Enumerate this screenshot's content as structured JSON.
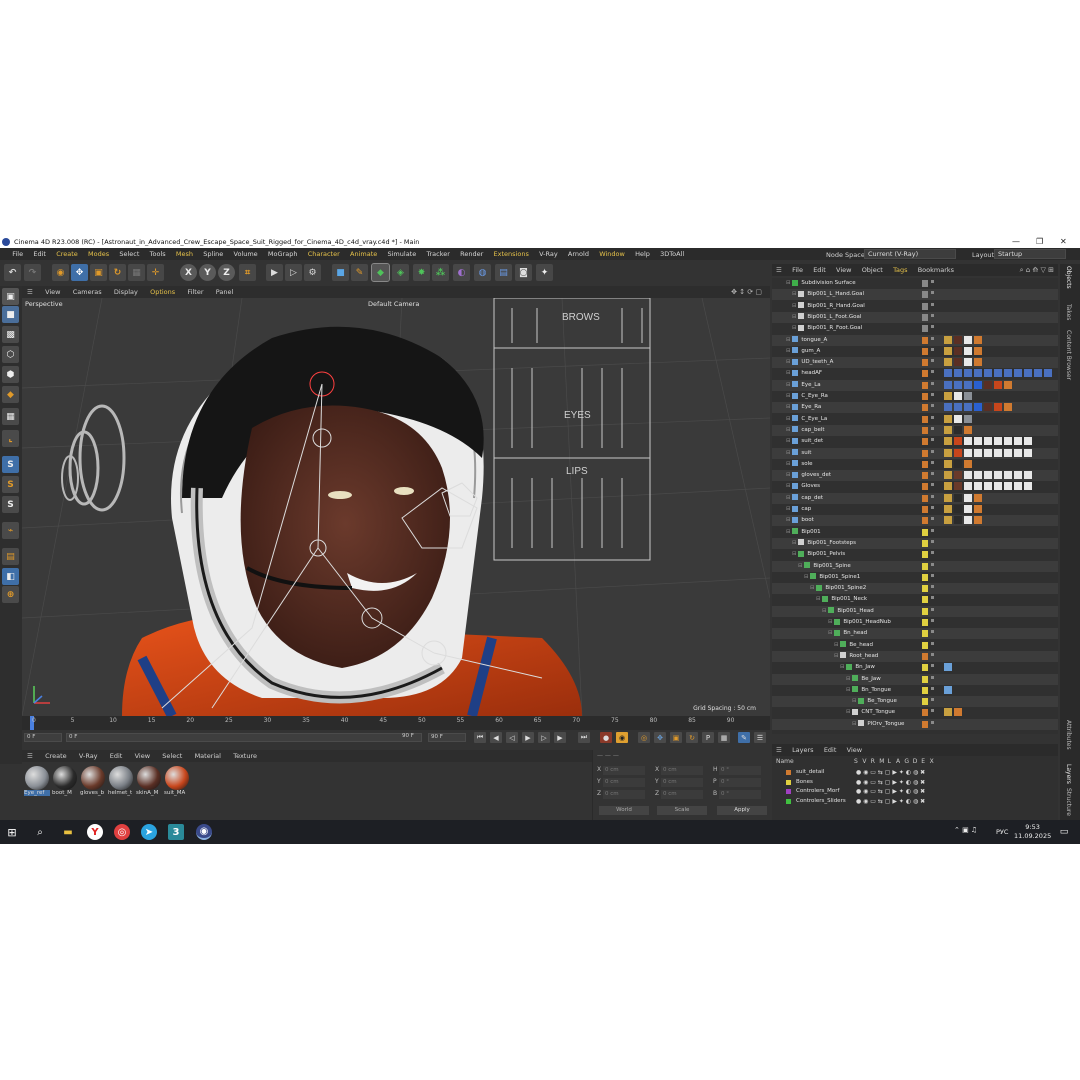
{
  "window": {
    "title": "Cinema 4D R23.008 (RC) - [Astronaut_in_Advanced_Crew_Escape_Space_Suit_Rigged_for_Cinema_4D_c4d_vray.c4d *] - Main",
    "controls": [
      "—",
      "❐",
      "✕"
    ]
  },
  "menu": [
    "File",
    "Edit",
    "Create",
    "Modes",
    "Select",
    "Tools",
    "Mesh",
    "Spline",
    "Volume",
    "MoGraph",
    "Character",
    "Animate",
    "Simulate",
    "Tracker",
    "Render",
    "Extensions",
    "V-Ray",
    "Arnold",
    "Window",
    "Help",
    "3DToAll"
  ],
  "node_space": {
    "label": "Node Space:",
    "value": "Current (V-Ray)"
  },
  "layout": {
    "label": "Layout:",
    "value": "Startup"
  },
  "viewport": {
    "menu": [
      "View",
      "Cameras",
      "Display",
      "Options",
      "Filter",
      "Panel"
    ],
    "label": "Perspective",
    "camera": "Default Camera",
    "grid_spacing": "Grid Spacing : 50 cm",
    "panel_labels": [
      "BROWS",
      "EYES",
      "LIPS"
    ]
  },
  "timeline": {
    "ticks": [
      "0",
      "5",
      "10",
      "15",
      "20",
      "25",
      "30",
      "35",
      "40",
      "45",
      "50",
      "55",
      "60",
      "65",
      "70",
      "75",
      "80",
      "85",
      "90"
    ],
    "current_frame": "0 F",
    "start": "0 F",
    "start2": "0 F",
    "end": "90 F",
    "end2": "90 F"
  },
  "materials": {
    "menu": [
      "Create",
      "V-Ray",
      "Edit",
      "View",
      "Select",
      "Material",
      "Texture"
    ],
    "items": [
      {
        "label": "Eye_ref",
        "color": "#8a8f96"
      },
      {
        "label": "boot_M",
        "color": "#2b2b2b"
      },
      {
        "label": "gloves_b",
        "color": "#6a3a2a"
      },
      {
        "label": "helmet_t",
        "color": "#7a7f86"
      },
      {
        "label": "skinA_M",
        "color": "#5a2f24"
      },
      {
        "label": "suit_MA",
        "color": "#c8461c"
      }
    ]
  },
  "coordinates": {
    "rows": [
      {
        "a": "X",
        "av": "0 cm",
        "b": "X",
        "bv": "0 cm",
        "c": "H",
        "cv": "0 °"
      },
      {
        "a": "Y",
        "av": "0 cm",
        "b": "Y",
        "bv": "0 cm",
        "c": "P",
        "cv": "0 °"
      },
      {
        "a": "Z",
        "av": "0 cm",
        "b": "Z",
        "bv": "0 cm",
        "c": "B",
        "cv": "0 °"
      }
    ],
    "mode": "World",
    "scale": "Scale",
    "apply": "Apply"
  },
  "objects": {
    "menu": [
      "File",
      "Edit",
      "View",
      "Object",
      "Tags",
      "Bookmarks"
    ],
    "rows": [
      {
        "name": "Subdivision Surface",
        "indent": 0,
        "icon": "#3fae4a",
        "color": "#888888",
        "tags": []
      },
      {
        "name": "Bip001_L_Hand.Goal",
        "indent": 1,
        "icon": "#d0d0d0",
        "color": "#888888",
        "tags": []
      },
      {
        "name": "Bip001_R_Hand.Goal",
        "indent": 1,
        "icon": "#d0d0d0",
        "color": "#888888",
        "tags": []
      },
      {
        "name": "Bip001_L_Foot.Goal",
        "indent": 1,
        "icon": "#d0d0d0",
        "color": "#888888",
        "tags": []
      },
      {
        "name": "Bip001_R_Foot.Goal",
        "indent": 1,
        "icon": "#d0d0d0",
        "color": "#888888",
        "tags": []
      },
      {
        "name": "tongue_A",
        "indent": 0,
        "icon": "#6aa0d8",
        "color": "#d07a30",
        "tags": [
          "#c8a040",
          "#5a2f24",
          "#e8e8e8",
          "#d07a30"
        ]
      },
      {
        "name": "gum_A",
        "indent": 0,
        "icon": "#6aa0d8",
        "color": "#d07a30",
        "tags": [
          "#c8a040",
          "#5a2f24",
          "#e8e8e8",
          "#d07a30"
        ]
      },
      {
        "name": "UD_teeth_A",
        "indent": 0,
        "icon": "#6aa0d8",
        "color": "#d07a30",
        "tags": [
          "#c8a040",
          "#5a2f24",
          "#e8e8e8",
          "#d07a30"
        ]
      },
      {
        "name": "headAF",
        "indent": 0,
        "icon": "#6aa0d8",
        "color": "#d07a30",
        "tags": [
          "#4a70c0",
          "#4a70c0",
          "#4a70c0",
          "#4a70c0",
          "#4a70c0",
          "#4a70c0",
          "#4a70c0",
          "#4a70c0",
          "#4a70c0",
          "#4a70c0",
          "#4a70c0"
        ]
      },
      {
        "name": "Eye_La",
        "indent": 0,
        "icon": "#6aa0d8",
        "color": "#d07a30",
        "tags": [
          "#4a70c0",
          "#4a70c0",
          "#4a70c0",
          "#2a60d0",
          "#5a2f24",
          "#c8461c",
          "#d07a30"
        ]
      },
      {
        "name": "C_Eye_Ra",
        "indent": 0,
        "icon": "#6aa0d8",
        "color": "#d07a30",
        "tags": [
          "#c8a040",
          "#e8e8e8",
          "#8a8f96"
        ]
      },
      {
        "name": "Eye_Ra",
        "indent": 0,
        "icon": "#6aa0d8",
        "color": "#d07a30",
        "tags": [
          "#4a70c0",
          "#4a70c0",
          "#4a70c0",
          "#2a60d0",
          "#5a2f24",
          "#c8461c",
          "#d07a30"
        ]
      },
      {
        "name": "C_Eye_La",
        "indent": 0,
        "icon": "#6aa0d8",
        "color": "#d07a30",
        "tags": [
          "#c8a040",
          "#e8e8e8",
          "#8a8f96"
        ]
      },
      {
        "name": "cap_belt",
        "indent": 0,
        "icon": "#6aa0d8",
        "color": "#d07a30",
        "tags": [
          "#c8a040",
          "#2b2b2b",
          "#d07a30"
        ]
      },
      {
        "name": "suit_det",
        "indent": 0,
        "icon": "#6aa0d8",
        "color": "#d07a30",
        "tags": [
          "#c8a040",
          "#c8461c",
          "#e8e8e8",
          "#e8e8e8",
          "#e8e8e8",
          "#e8e8e8",
          "#e8e8e8",
          "#e8e8e8",
          "#e8e8e8"
        ]
      },
      {
        "name": "suit",
        "indent": 0,
        "icon": "#6aa0d8",
        "color": "#d07a30",
        "tags": [
          "#c8a040",
          "#c8461c",
          "#e8e8e8",
          "#e8e8e8",
          "#e8e8e8",
          "#e8e8e8",
          "#e8e8e8",
          "#e8e8e8",
          "#e8e8e8"
        ]
      },
      {
        "name": "sole",
        "indent": 0,
        "icon": "#6aa0d8",
        "color": "#d07a30",
        "tags": [
          "#c8a040",
          "#2b2b2b",
          "#d07a30"
        ]
      },
      {
        "name": "gloves_det",
        "indent": 0,
        "icon": "#6aa0d8",
        "color": "#d07a30",
        "tags": [
          "#c8a040",
          "#6a3a2a",
          "#e8e8e8",
          "#e8e8e8",
          "#e8e8e8",
          "#e8e8e8",
          "#e8e8e8",
          "#e8e8e8",
          "#e8e8e8"
        ]
      },
      {
        "name": "Gloves",
        "indent": 0,
        "icon": "#6aa0d8",
        "color": "#d07a30",
        "tags": [
          "#c8a040",
          "#6a3a2a",
          "#e8e8e8",
          "#e8e8e8",
          "#e8e8e8",
          "#e8e8e8",
          "#e8e8e8",
          "#e8e8e8",
          "#e8e8e8"
        ]
      },
      {
        "name": "cap_det",
        "indent": 0,
        "icon": "#6aa0d8",
        "color": "#d07a30",
        "tags": [
          "#c8a040",
          "#2b2b2b",
          "#e8e8e8",
          "#d07a30"
        ]
      },
      {
        "name": "cap",
        "indent": 0,
        "icon": "#6aa0d8",
        "color": "#d07a30",
        "tags": [
          "#c8a040",
          "#2b2b2b",
          "#e8e8e8",
          "#d07a30"
        ]
      },
      {
        "name": "boot",
        "indent": 0,
        "icon": "#6aa0d8",
        "color": "#d07a30",
        "tags": [
          "#c8a040",
          "#2b2b2b",
          "#e8e8e8",
          "#d07a30"
        ]
      },
      {
        "name": "Bip001",
        "indent": 0,
        "icon": "#4fae5a",
        "color": "#e0d040",
        "tags": []
      },
      {
        "name": "Bip001_Footsteps",
        "indent": 1,
        "icon": "#d0d0d0",
        "color": "#e0d040",
        "tags": []
      },
      {
        "name": "Bip001_Pelvis",
        "indent": 1,
        "icon": "#4fae5a",
        "color": "#e0d040",
        "tags": []
      },
      {
        "name": "Bip001_Spine",
        "indent": 2,
        "icon": "#4fae5a",
        "color": "#e0d040",
        "tags": []
      },
      {
        "name": "Bip001_Spine1",
        "indent": 3,
        "icon": "#4fae5a",
        "color": "#e0d040",
        "tags": []
      },
      {
        "name": "Bip001_Spine2",
        "indent": 4,
        "icon": "#4fae5a",
        "color": "#e0d040",
        "tags": []
      },
      {
        "name": "Bip001_Neck",
        "indent": 5,
        "icon": "#4fae5a",
        "color": "#e0d040",
        "tags": []
      },
      {
        "name": "Bip001_Head",
        "indent": 6,
        "icon": "#4fae5a",
        "color": "#e0d040",
        "tags": []
      },
      {
        "name": "Bip001_HeadNub",
        "indent": 7,
        "icon": "#4fae5a",
        "color": "#e0d040",
        "tags": []
      },
      {
        "name": "Bn_head",
        "indent": 7,
        "icon": "#4fae5a",
        "color": "#e0d040",
        "tags": []
      },
      {
        "name": "Be_head",
        "indent": 8,
        "icon": "#4fae5a",
        "color": "#e0d040",
        "tags": []
      },
      {
        "name": "Root_head",
        "indent": 8,
        "icon": "#d0d0d0",
        "color": "#d07a30",
        "tags": []
      },
      {
        "name": "Bn_Jaw",
        "indent": 9,
        "icon": "#4fae5a",
        "color": "#e0d040",
        "tags": [
          "#6aa0d8"
        ]
      },
      {
        "name": "Be_Jaw",
        "indent": 10,
        "icon": "#4fae5a",
        "color": "#e0d040",
        "tags": []
      },
      {
        "name": "Bn_Tongue",
        "indent": 10,
        "icon": "#4fae5a",
        "color": "#e0d040",
        "tags": [
          "#6aa0d8"
        ]
      },
      {
        "name": "Be_Tongue",
        "indent": 11,
        "icon": "#4fae5a",
        "color": "#e0d040",
        "tags": []
      },
      {
        "name": "CNT_Tongue",
        "indent": 10,
        "icon": "#d0d0d0",
        "color": "#d07a30",
        "tags": [
          "#c8a040",
          "#d07a30"
        ]
      },
      {
        "name": "PlOrv_Tongue",
        "indent": 11,
        "icon": "#d0d0d0",
        "color": "#d07a30",
        "tags": []
      }
    ]
  },
  "layers": {
    "menu": [
      "Layers",
      "Edit",
      "View"
    ],
    "header": {
      "name": "Name",
      "cols": [
        "S",
        "V",
        "R",
        "M",
        "L",
        "A",
        "G",
        "D",
        "E",
        "X"
      ]
    },
    "items": [
      {
        "name": "suit_detail",
        "color": "#d07a30"
      },
      {
        "name": "Bones",
        "color": "#e0d040"
      },
      {
        "name": "Controlers_Morf",
        "color": "#a040c0"
      },
      {
        "name": "Controlers_Sliders",
        "color": "#40c040"
      }
    ]
  },
  "sidetabs": [
    "Objects",
    "Takes",
    "Content Browser",
    "Attributes",
    "Layers",
    "Structure"
  ],
  "taskbar": {
    "language": "РУС",
    "time": "9:53",
    "date": "11.09.2025"
  }
}
